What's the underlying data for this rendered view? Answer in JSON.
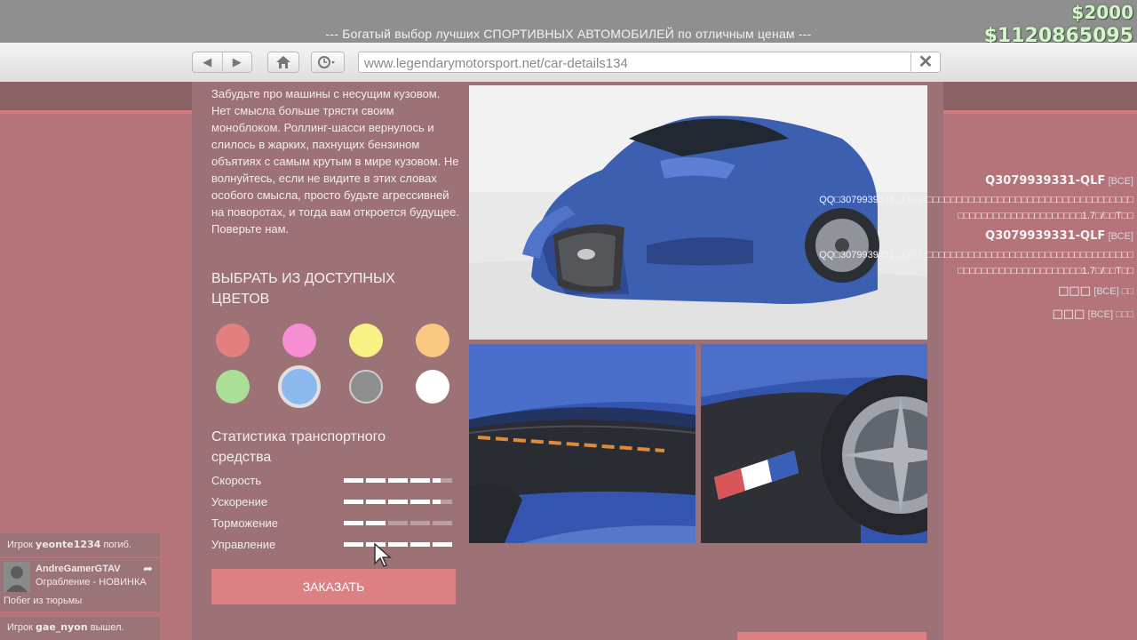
{
  "banner": {
    "title": "--- Богатый выбор лучших СПОРТИВНЫХ АВТОМОБИЛЕЙ по отличным ценам ---"
  },
  "hud": {
    "money_small": "$2000",
    "money_big": "$1120865095"
  },
  "browser": {
    "url": "www.legendarymotorsport.net/car-details134",
    "back_icon": "back-arrow-icon",
    "forward_icon": "forward-arrow-icon",
    "home_icon": "home-icon",
    "history_icon": "clock-icon",
    "close_icon": "close-icon"
  },
  "product": {
    "description": "Забудьте про машины с несущим кузовом. Нет смысла больше трясти своим моноблоком. Роллинг-шасси вернулось и слилось в жарких, пахнущих бензином объятиях с самым крутым в мире кузовом. Не волнуйтесь, если не видите в этих словах особого смысла, просто будьте агрессивней на поворотах, и тогда вам откроется будущее. Поверьте нам.",
    "colors_title": "ВЫБРАТЬ ИЗ ДОСТУПНЫХ ЦВЕТОВ",
    "colors": [
      {
        "name": "red",
        "hex": "#e47f80",
        "selected": false
      },
      {
        "name": "pink",
        "hex": "#f78ed3",
        "selected": false
      },
      {
        "name": "yellow",
        "hex": "#f8f184",
        "selected": false
      },
      {
        "name": "orange",
        "hex": "#f9c983",
        "selected": false
      },
      {
        "name": "green",
        "hex": "#abdf98",
        "selected": false
      },
      {
        "name": "blue",
        "hex": "#8bb9ee",
        "selected": true
      },
      {
        "name": "grey",
        "hex": "#8f8f8f",
        "selected": false
      },
      {
        "name": "white",
        "hex": "#ffffff",
        "selected": false
      }
    ],
    "stats_title": "Статистика транспортного средства",
    "stats": [
      {
        "label": "Скорость",
        "level": 4.4
      },
      {
        "label": "Ускорение",
        "level": 4.4
      },
      {
        "label": "Торможение",
        "level": 2
      },
      {
        "label": "Управление",
        "level": 5
      }
    ],
    "order_label": "ЗАКАЗАТЬ"
  },
  "feed_right": [
    {
      "name": "Q3079939331-QLF",
      "tag": "[ВСЕ]"
    },
    {
      "text": "QQ□3079939331,□□□□□□□□□□□□□□□□□□□□□□□□□□□□□□□□□□□□□□□□"
    },
    {
      "text": "□□□□□□□□□□□□□□□□□□□□□1.7□/□□T□□"
    },
    {
      "name": "Q3079939331-QLF",
      "tag": "[ВСЕ]"
    },
    {
      "text": "QQ□3079939331,□□□□□□□□□□□□□□□□□□□□□□□□□□□□□□□□□□□□□□□□"
    },
    {
      "text": "□□□□□□□□□□□□□□□□□□□□□1.7□/□□T□□"
    },
    {
      "name": "□□□",
      "tag": "[ВСЕ] □□"
    },
    {
      "name": "□□□",
      "tag": "[ВСЕ] □□□"
    }
  ],
  "feed_left": {
    "msg1_prefix": "Игрок",
    "msg1_player": "yeonte1234",
    "msg1_suffix": "погиб.",
    "user": "AndreGamerGTAV",
    "activity": "Ограбление  - НОВИНКА",
    "msg2": "Побег из тюрьмы",
    "msg3_prefix": "Игрок",
    "msg3_player": "gae_nyon",
    "msg3_suffix": "вышел."
  }
}
